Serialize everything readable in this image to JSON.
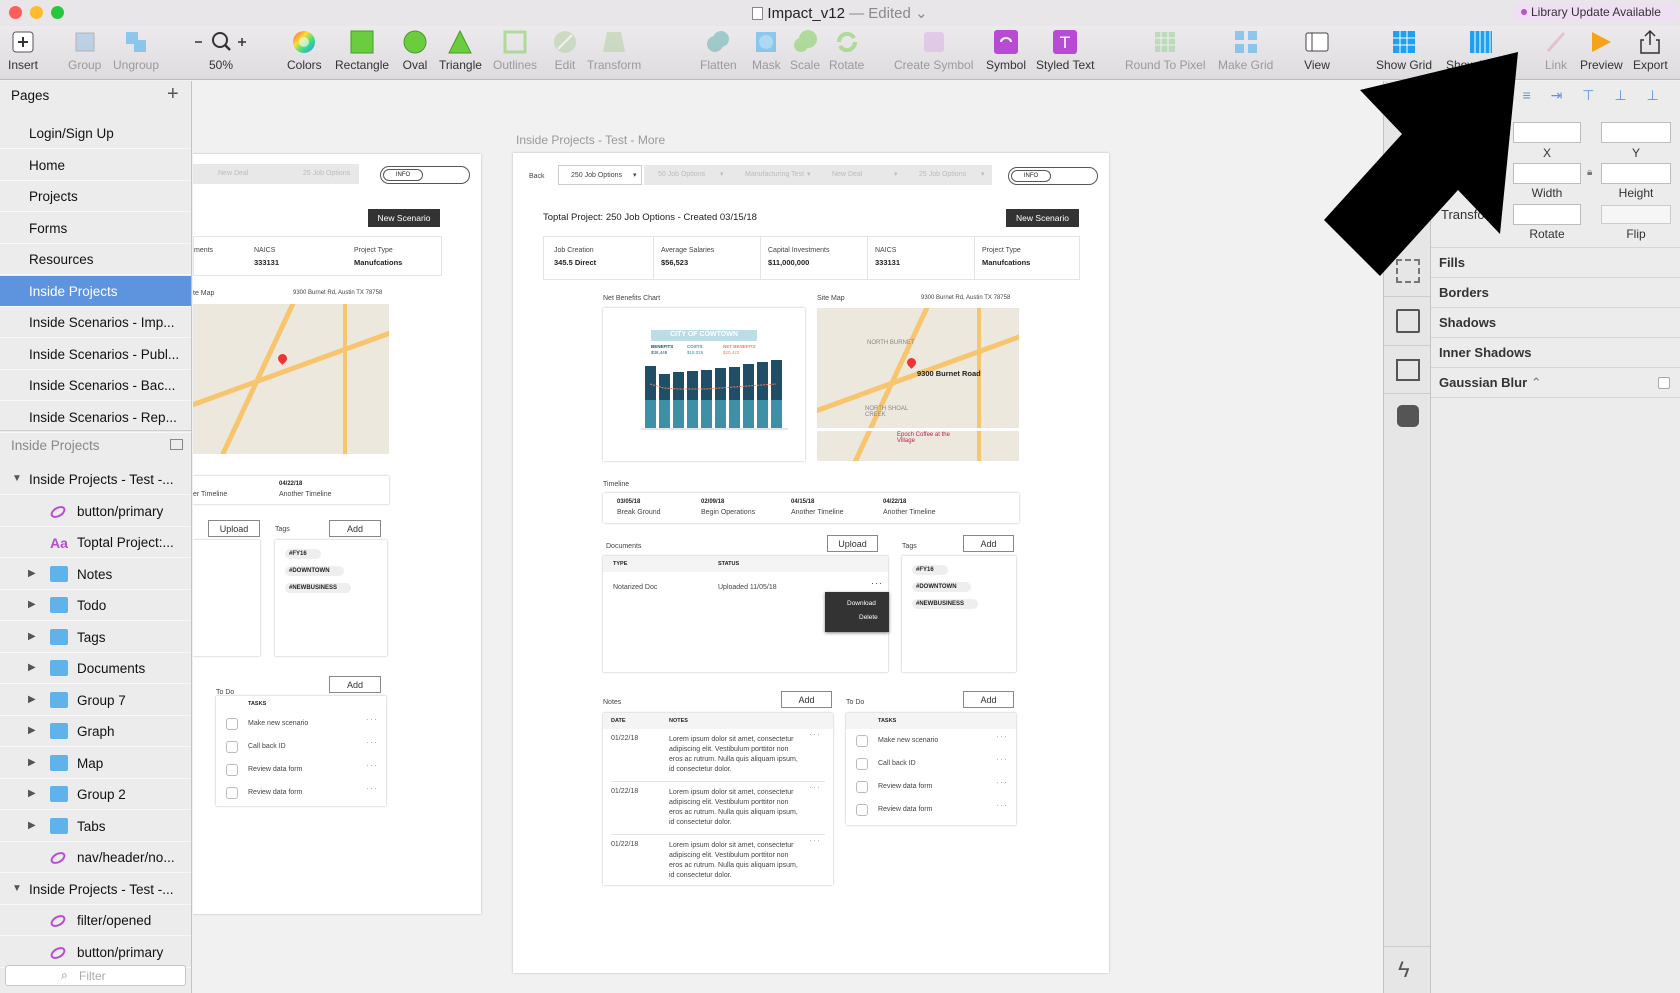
{
  "window": {
    "title": "Impact_v12",
    "edited": "— Edited",
    "library_badge": "Library Update Available"
  },
  "toolbar": {
    "insert": "Insert",
    "group": "Group",
    "ungroup": "Ungroup",
    "zoom": "50%",
    "colors": "Colors",
    "rectangle": "Rectangle",
    "oval": "Oval",
    "triangle": "Triangle",
    "outlines": "Outlines",
    "edit": "Edit",
    "transform": "Transform",
    "flatten": "Flatten",
    "mask": "Mask",
    "scale": "Scale",
    "rotate": "Rotate",
    "create_symbol": "Create Symbol",
    "symbol": "Symbol",
    "styled_text": "Styled Text",
    "round_to_pixel": "Round To Pixel",
    "make_grid": "Make Grid",
    "view": "View",
    "show_grid": "Show Grid",
    "show_layout": "Show Layout",
    "link": "Link",
    "preview": "Preview",
    "export": "Export"
  },
  "pages": {
    "header": "Pages",
    "items": [
      "Login/Sign Up",
      "Home",
      "Projects",
      "Forms",
      "Resources",
      "Inside Projects",
      "Inside Scenarios - Imp...",
      "Inside Scenarios - Publ...",
      "Inside Scenarios - Bac...",
      "Inside Scenarios - Rep..."
    ],
    "selected": "Inside Projects"
  },
  "layers": {
    "header": "Inside Projects",
    "items": [
      {
        "label": "Inside Projects - Test -...",
        "kind": "artboard"
      },
      {
        "label": "button/primary",
        "kind": "symbol"
      },
      {
        "label": "Toptal Project:...",
        "kind": "text"
      },
      {
        "label": "Notes",
        "kind": "folder"
      },
      {
        "label": "Todo",
        "kind": "folder"
      },
      {
        "label": "Tags",
        "kind": "folder"
      },
      {
        "label": "Documents",
        "kind": "folder"
      },
      {
        "label": "Group 7",
        "kind": "folder"
      },
      {
        "label": "Graph",
        "kind": "folder"
      },
      {
        "label": "Map",
        "kind": "folder"
      },
      {
        "label": "Group 2",
        "kind": "folder"
      },
      {
        "label": "Tabs",
        "kind": "folder"
      },
      {
        "label": "nav/header/no...",
        "kind": "symbol"
      },
      {
        "label": "Inside Projects - Test -...",
        "kind": "artboard"
      },
      {
        "label": "filter/opened",
        "kind": "symbol"
      },
      {
        "label": "button/primary",
        "kind": "symbol"
      }
    ],
    "filter_placeholder": "Filter"
  },
  "artboard": {
    "label": "Inside Projects - Test - More",
    "back": "Back",
    "job_options": "250 Job Options",
    "filter_tabs": [
      "50 Job Options",
      "Manufacturing Test",
      "New Deal",
      "25 Job Options"
    ],
    "info": "INFO",
    "project_title": "Toptal Project: 250 Job Options - Created 03/15/18",
    "new_scenario": "New Scenario",
    "stats": [
      {
        "label": "Job Creation",
        "value": "345.5 Direct"
      },
      {
        "label": "Average Salaries",
        "value": "$56,523"
      },
      {
        "label": "Capital Investments",
        "value": "$11,000,000"
      },
      {
        "label": "NAICS",
        "value": "333131"
      },
      {
        "label": "Project Type",
        "value": "Manufcations"
      }
    ],
    "net_benefits": "Net Benefits Chart",
    "chart_title": "CITY OF COWTOWN",
    "chart_legend": [
      "BENEFITS",
      "COSTS",
      "NET BENEFITS"
    ],
    "chart_legend_values": [
      "$38,449",
      "$18,026",
      "$20,423"
    ],
    "site_map": "Site Map",
    "address": "9300 Burnet Rd, Austin TX 78758",
    "map_pin": "9300 Burnet Road",
    "map_labels": [
      "NORTH BURNET",
      "NORTH SHOAL CREEK",
      "Epoch Coffee at the Village"
    ],
    "timeline": "Timeline",
    "timeline_items": [
      {
        "date": "03/05/18",
        "label": "Break Ground"
      },
      {
        "date": "02/09/18",
        "label": "Begin Operations"
      },
      {
        "date": "04/15/18",
        "label": "Another Timeline"
      },
      {
        "date": "04/22/18",
        "label": "Another Timeline"
      }
    ],
    "documents": "Documents",
    "upload": "Upload",
    "doc_cols": [
      "TYPE",
      "STATUS"
    ],
    "doc_row": {
      "type": "Notarized Doc",
      "status": "Uploaded 11/05/18"
    },
    "doc_menu": [
      "Download",
      "Delete"
    ],
    "tags": "Tags",
    "add": "Add",
    "tag_items": [
      "#FY16",
      "#DOWNTOWN",
      "#NEWBUSINESS"
    ],
    "notes": "Notes",
    "notes_cols": [
      "DATE",
      "NOTES"
    ],
    "notes_rows": [
      {
        "date": "01/22/18",
        "text": "Lorem ipsum dolor sit amet, consectetur adipiscing elit. Vestibulum porttitor non eros ac rutrum. Nulla quis aliquam ipsum, id consectetur dolor."
      },
      {
        "date": "01/22/18",
        "text": "Lorem ipsum dolor sit amet, consectetur adipiscing elit. Vestibulum porttitor non eros ac rutrum. Nulla quis aliquam ipsum, id consectetur dolor."
      },
      {
        "date": "01/22/18",
        "text": "Lorem ipsum dolor sit amet, consectetur adipiscing elit. Vestibulum porttitor non eros ac rutrum. Nulla quis aliquam ipsum, id consectetur dolor."
      }
    ],
    "todo": "To Do",
    "tasks_col": "TASKS",
    "tasks": [
      "Make new scenario",
      "Call back ID",
      "Review data form",
      "Review data form"
    ]
  },
  "left_board": {
    "new_deal": "New Deal",
    "job_options": "25 Job Options",
    "info": "INFO",
    "new_scenario": "New Scenario",
    "stat_partial": "ments",
    "naics_label": "NAICS",
    "naics": "333131",
    "ptype_label": "Project Type",
    "ptype": "Manufcations",
    "site_map": "te Map",
    "address": "9300 Burnet Rd, Austin TX 78758",
    "timeline_date": "04/22/18",
    "timeline_a": "er Timeline",
    "timeline_b": "Another Timeline",
    "upload": "Upload",
    "tags": "Tags",
    "add": "Add",
    "todo": "To Do"
  },
  "inspector": {
    "x": "X",
    "y": "Y",
    "width": "Width",
    "height": "Height",
    "transform": "Transform",
    "rotate": "Rotate",
    "flip": "Flip",
    "fills": "Fills",
    "borders": "Borders",
    "shadows": "Shadows",
    "inner_shadows": "Inner Shadows",
    "gaussian_blur": "Gaussian Blur"
  },
  "colors": {
    "selection": "#5e94dd",
    "symbol_purple": "#b84bd3",
    "chart_dark": "#1f4e66",
    "chart_light": "#3d90a6"
  }
}
